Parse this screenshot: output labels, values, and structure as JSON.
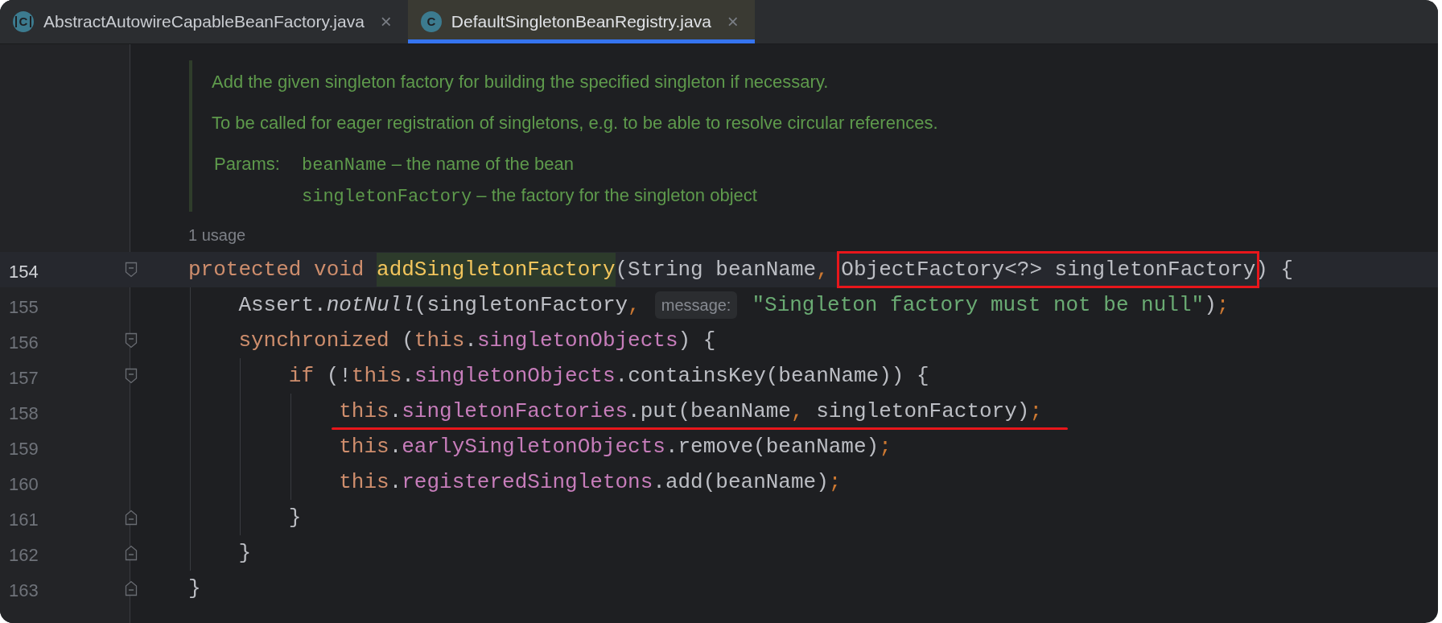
{
  "tabs": [
    {
      "label": "AbstractAutowireCapableBeanFactory.java",
      "icon": "C",
      "kind": "abstract-class",
      "close": "×",
      "selected": false
    },
    {
      "label": "DefaultSingletonBeanRegistry.java",
      "icon": "C",
      "kind": "class",
      "close": "×",
      "selected": true
    }
  ],
  "doc": {
    "paragraphs": [
      "Add the given singleton factory for building the specified singleton if necessary.",
      "To be called for eager registration of singletons, e.g. to be able to resolve circular references."
    ],
    "params_label": "Params:",
    "params": [
      {
        "name": "beanName",
        "desc": " – the name of the bean"
      },
      {
        "name": "singletonFactory",
        "desc": " – the factory for the singleton object"
      }
    ]
  },
  "usage_hint": "1 usage",
  "lines": [
    {
      "number": "154",
      "current": true,
      "kind": "fold-start",
      "underlined": false,
      "segments": [
        {
          "kind": "code",
          "tokens": [
            {
              "kind": "keyword",
              "t": "protected void "
            }
          ]
        },
        {
          "kind": "usage-highlight",
          "tokens": [
            {
              "kind": "method",
              "t": "addSingletonFactory"
            }
          ]
        },
        {
          "kind": "code",
          "tokens": [
            {
              "kind": "plain",
              "t": "(String beanName"
            },
            {
              "kind": "punct",
              "t": ", "
            }
          ]
        },
        {
          "kind": "boxed",
          "tokens": [
            {
              "kind": "plain",
              "t": "ObjectFactory<?> singletonFactory"
            }
          ]
        },
        {
          "kind": "code",
          "tokens": [
            {
              "kind": "plain",
              "t": ") {"
            }
          ]
        }
      ]
    },
    {
      "number": "155",
      "current": false,
      "kind": "plain",
      "underlined": false,
      "segments": [
        {
          "kind": "code",
          "tokens": [
            {
              "kind": "plain",
              "t": "    Assert."
            },
            {
              "kind": "italic",
              "t": "notNull"
            },
            {
              "kind": "plain",
              "t": "(singletonFactory"
            },
            {
              "kind": "punct",
              "t": ","
            }
          ]
        },
        {
          "kind": "hint",
          "text": "message:"
        },
        {
          "kind": "code",
          "tokens": [
            {
              "kind": "string",
              "t": "\"Singleton factory must not be null\""
            },
            {
              "kind": "plain",
              "t": ")"
            },
            {
              "kind": "punct",
              "t": ";"
            }
          ]
        }
      ]
    },
    {
      "number": "156",
      "current": false,
      "kind": "fold-start",
      "underlined": false,
      "segments": [
        {
          "kind": "code",
          "tokens": [
            {
              "kind": "keyword",
              "t": "    synchronized "
            },
            {
              "kind": "plain",
              "t": "("
            },
            {
              "kind": "keyword",
              "t": "this"
            },
            {
              "kind": "plain",
              "t": "."
            },
            {
              "kind": "field",
              "t": "singletonObjects"
            },
            {
              "kind": "plain",
              "t": ") {"
            }
          ]
        }
      ]
    },
    {
      "number": "157",
      "current": false,
      "kind": "fold-start",
      "underlined": false,
      "segments": [
        {
          "kind": "code",
          "tokens": [
            {
              "kind": "keyword",
              "t": "        if "
            },
            {
              "kind": "plain",
              "t": "(!"
            },
            {
              "kind": "keyword",
              "t": "this"
            },
            {
              "kind": "plain",
              "t": "."
            },
            {
              "kind": "field",
              "t": "singletonObjects"
            },
            {
              "kind": "plain",
              "t": ".containsKey(beanName)) {"
            }
          ]
        }
      ]
    },
    {
      "number": "158",
      "current": false,
      "kind": "plain",
      "underlined": true,
      "segments": [
        {
          "kind": "code",
          "tokens": [
            {
              "kind": "keyword",
              "t": "            this"
            },
            {
              "kind": "plain",
              "t": "."
            },
            {
              "kind": "field",
              "t": "singletonFactories"
            },
            {
              "kind": "plain",
              "t": ".put(beanName"
            },
            {
              "kind": "punct",
              "t": ", "
            },
            {
              "kind": "plain",
              "t": "singletonFactory)"
            },
            {
              "kind": "punct",
              "t": ";"
            }
          ]
        }
      ]
    },
    {
      "number": "159",
      "current": false,
      "kind": "plain",
      "underlined": false,
      "segments": [
        {
          "kind": "code",
          "tokens": [
            {
              "kind": "keyword",
              "t": "            this"
            },
            {
              "kind": "plain",
              "t": "."
            },
            {
              "kind": "field",
              "t": "earlySingletonObjects"
            },
            {
              "kind": "plain",
              "t": ".remove(beanName)"
            },
            {
              "kind": "punct",
              "t": ";"
            }
          ]
        }
      ]
    },
    {
      "number": "160",
      "current": false,
      "kind": "plain",
      "underlined": false,
      "segments": [
        {
          "kind": "code",
          "tokens": [
            {
              "kind": "keyword",
              "t": "            this"
            },
            {
              "kind": "plain",
              "t": "."
            },
            {
              "kind": "field",
              "t": "registeredSingletons"
            },
            {
              "kind": "plain",
              "t": ".add(beanName)"
            },
            {
              "kind": "punct",
              "t": ";"
            }
          ]
        }
      ]
    },
    {
      "number": "161",
      "current": false,
      "kind": "fold-end",
      "underlined": false,
      "segments": [
        {
          "kind": "code",
          "tokens": [
            {
              "kind": "plain",
              "t": "        }"
            }
          ]
        }
      ]
    },
    {
      "number": "162",
      "current": false,
      "kind": "fold-end",
      "underlined": false,
      "segments": [
        {
          "kind": "code",
          "tokens": [
            {
              "kind": "plain",
              "t": "    }"
            }
          ]
        }
      ]
    },
    {
      "number": "163",
      "current": false,
      "kind": "fold-end",
      "underlined": false,
      "segments": [
        {
          "kind": "code",
          "tokens": [
            {
              "kind": "plain",
              "t": "}"
            }
          ]
        }
      ]
    }
  ]
}
